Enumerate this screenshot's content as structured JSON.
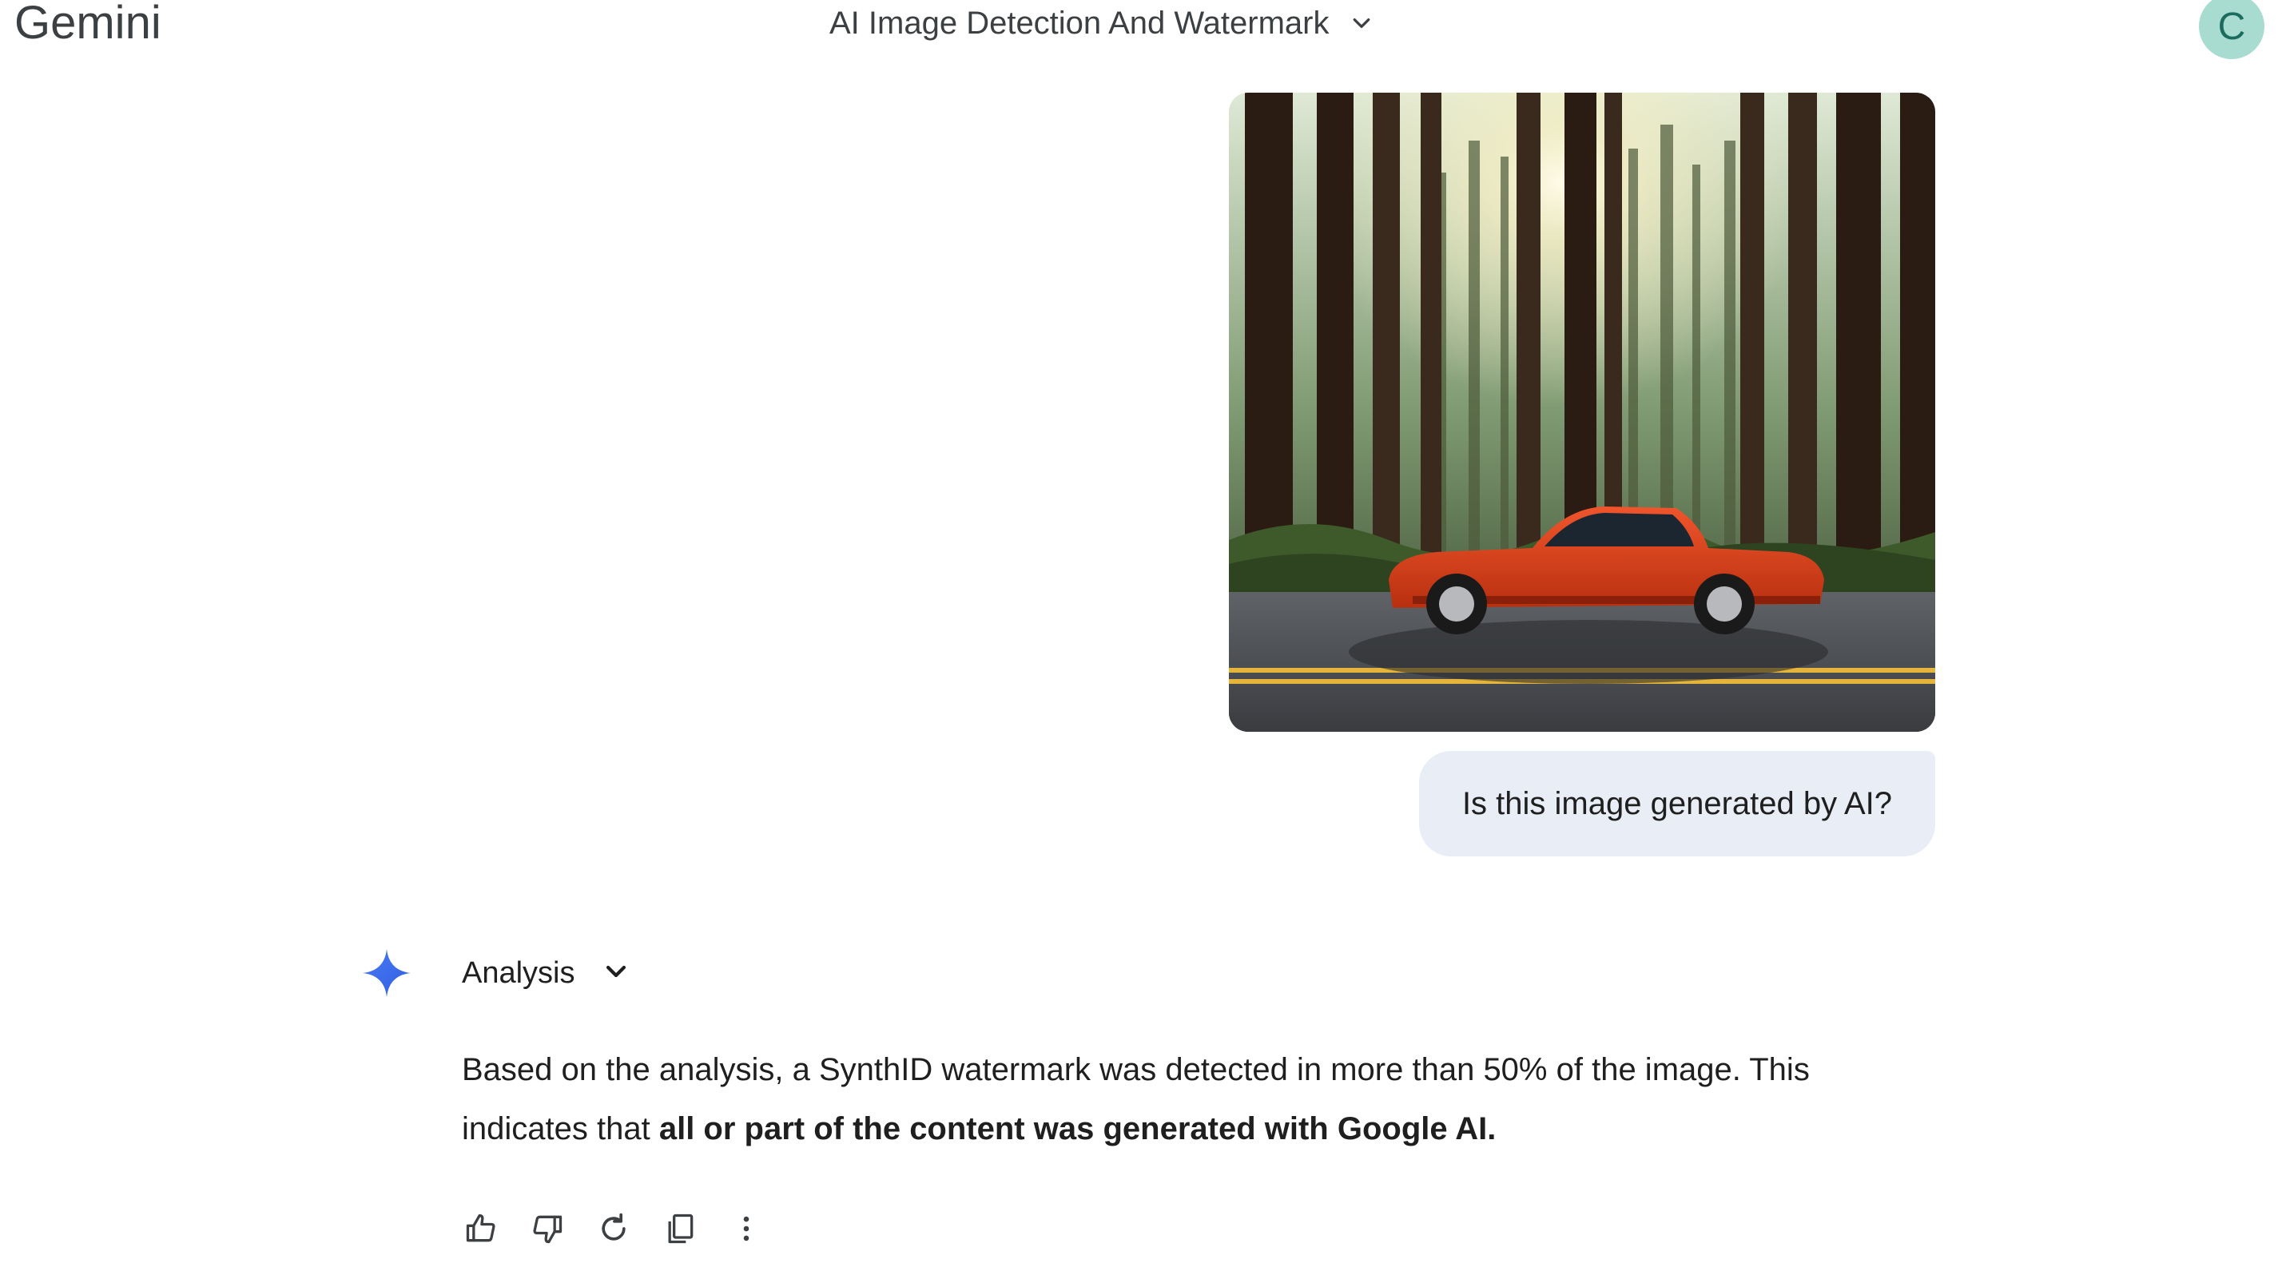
{
  "app": {
    "name": "Gemini"
  },
  "header": {
    "conversation_title": "AI Image Detection And Watermark",
    "account_initial": "C"
  },
  "conversation": {
    "user_image": {
      "subject": "Orange convertible sports car on a road through a redwood forest with sunlight"
    },
    "user_prompt": "Is this image generated by AI?",
    "response": {
      "section_label": "Analysis",
      "text_part1": "Based on the analysis, a SynthID watermark was detected in more than 50% of the image. This indicates that ",
      "text_bold": "all or part of the content was generated with Google AI."
    }
  },
  "icons": {
    "title_dropdown": "chevron-down-icon",
    "analysis_dropdown": "chevron-down-icon",
    "gemini_logo": "gemini-sparkle-icon",
    "actions": [
      "thumbs-up-icon",
      "thumbs-down-icon",
      "regenerate-icon",
      "copy-icon",
      "more-vert-icon"
    ]
  },
  "colors": {
    "user_bubble_bg": "#e9eef6",
    "avatar_bg": "#a8dcd1",
    "sparkle_blue": "#4285f4"
  }
}
